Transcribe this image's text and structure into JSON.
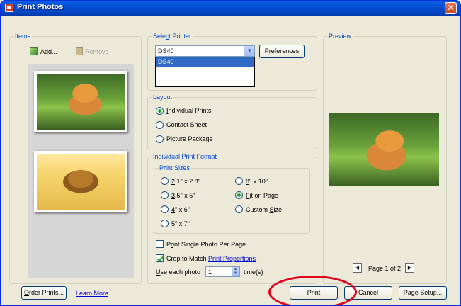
{
  "window": {
    "title": "Print Photos",
    "close_glyph": "✕"
  },
  "items": {
    "group_label": "Items",
    "add_label": "Add...",
    "remove_label": "Remove",
    "photos": [
      {
        "subject": "tiger",
        "icon": "tiger-photo"
      },
      {
        "subject": "lion",
        "icon": "lion-photo"
      }
    ]
  },
  "printer": {
    "group_label_pre": "Sele",
    "group_label_key": "c",
    "group_label_post": "t Printer",
    "selected": "DS40",
    "options": [
      "DS40"
    ],
    "preferences_label": "Preferences"
  },
  "layout": {
    "group_label": "Layout",
    "options": [
      {
        "key": "I",
        "rest": "ndividual Prints",
        "selected": true
      },
      {
        "key": "C",
        "rest": "ontact Sheet",
        "selected": false
      },
      {
        "key": "P",
        "rest": "icture Package",
        "selected": false
      }
    ]
  },
  "format": {
    "group_label": "Individual Print Format",
    "sizes_label": "Print Sizes",
    "sizes": [
      {
        "key": "2",
        "rest": ".1\" x 2.8\"",
        "selected": false
      },
      {
        "key": "3",
        "rest": ".5\" x 5\"",
        "selected": false
      },
      {
        "key": "4",
        "rest": "\" x 6\"",
        "selected": false
      },
      {
        "key": "5",
        "rest": "\" x 7\"",
        "selected": false
      },
      {
        "key": "8",
        "rest": "\" x 10\"",
        "selected": false
      },
      {
        "key": "F",
        "rest": "it on Page",
        "selected": true
      },
      {
        "pre": "Custom ",
        "key": "S",
        "rest": "ize",
        "selected": false
      }
    ],
    "single_photo": {
      "pre": "P",
      "key": "r",
      "rest": "int Single Photo Per Page",
      "checked": false
    },
    "crop": {
      "text": "Crop to Match ",
      "link": "Print Proportions",
      "checked": true
    },
    "use_each": {
      "key": "U",
      "rest": "se each photo",
      "value": "1",
      "suffix": "time(s)"
    }
  },
  "preview": {
    "group_label": "Preview",
    "page_label": "Page 1 of 2",
    "prev_glyph": "◀",
    "next_glyph": "▶"
  },
  "footer": {
    "order_key": "O",
    "order_rest": "rder Prints...",
    "learn_more": "Learn More",
    "print": "Print",
    "cancel": "Cancel",
    "page_setup": "Page Setup..."
  },
  "colors": {
    "accent": "#0046d5",
    "highlight": "#316ac5",
    "annotation": "#e0001a"
  }
}
